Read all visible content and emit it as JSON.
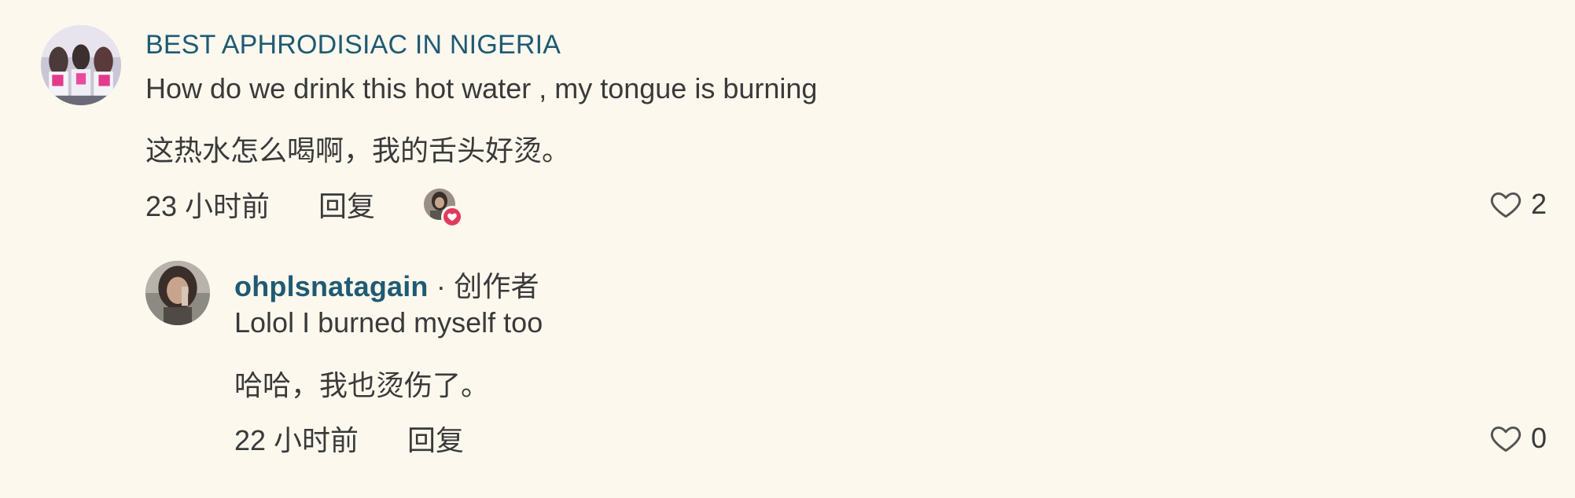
{
  "comments": [
    {
      "author": "BEST APHRODISIAC IN NIGERIA",
      "text_en": "How do we drink this hot water , my tongue is burning",
      "text_zh": "这热水怎么喝啊，我的舌头好烫。",
      "time": "23 小时前",
      "reply_label": "回复",
      "like_count": "2",
      "liked_by_creator": true
    }
  ],
  "replies": [
    {
      "author": "ohplsnatagain",
      "creator_tag": " · 创作者",
      "text_en": "Lolol I burned myself too",
      "text_zh": "哈哈，我也烫伤了。",
      "time": "22 小时前",
      "reply_label": "回复",
      "like_count": "0"
    }
  ],
  "colors": {
    "background": "#fcf8ee",
    "author": "#1f5a73",
    "text": "#3a3a3a",
    "heart_badge": "#e23a5c"
  },
  "icons": {
    "like": "heart-outline-icon",
    "liked_badge": "heart-filled-icon"
  }
}
